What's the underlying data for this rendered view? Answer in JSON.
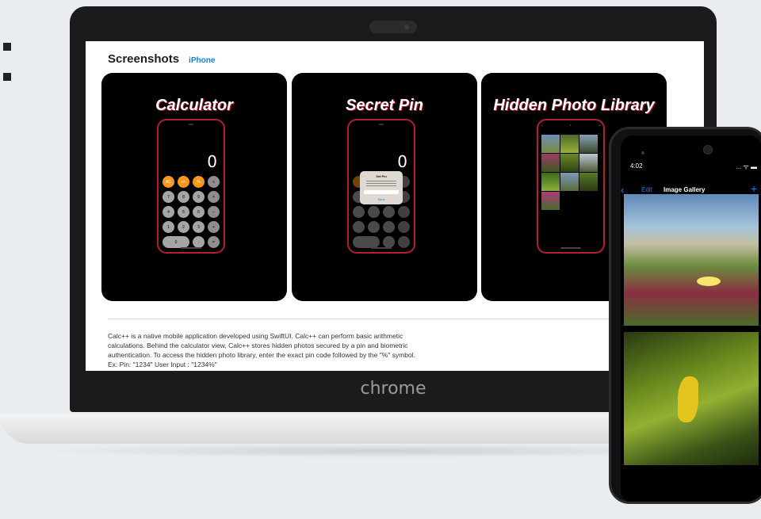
{
  "laptop": {
    "brand_label": "chrome"
  },
  "page": {
    "section_title": "Screenshots",
    "device_tab": "iPhone",
    "cards": [
      {
        "title": "Calculator",
        "display_value": "0",
        "keys": [
          "AC",
          "+/-",
          "%",
          "÷",
          "7",
          "8",
          "9",
          "×",
          "4",
          "5",
          "6",
          "−",
          "1",
          "2",
          "3",
          "+",
          "0",
          ".",
          "="
        ]
      },
      {
        "title": "Secret Pin",
        "display_value": "0",
        "dialog_title": "Set Pin",
        "dialog_button": "Save"
      },
      {
        "title": "Hidden Photo Library"
      }
    ],
    "description_lines": [
      "Calc++ is a native mobile application developed using SwiftUI. Calc++ can perform basic arithmetic",
      "calculations. Behind the calculator view, Calc++ stores hidden photos secured by a pin and biometric",
      "authentication. To access the hidden photo library, enter the exact pin code followed by the \"%\" symbol.",
      "Ex: Pin: \"1234\" User Input : \"1234%\""
    ]
  },
  "phone": {
    "time": "4:02",
    "status_icons": "... ᯤ ▬",
    "nav": {
      "back": "‹",
      "edit": "Edit",
      "title": "Image Gallery",
      "add": "+"
    }
  },
  "colors": {
    "accent_blue": "#1a7bd8",
    "calc_orange": "#f7981b",
    "card_outline_red": "#b3202c"
  }
}
